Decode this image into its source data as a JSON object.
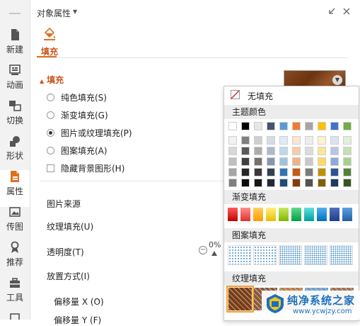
{
  "sidebar": {
    "items": [
      {
        "label": "新建",
        "icon": "new-doc-icon"
      },
      {
        "label": "动画",
        "icon": "animation-icon"
      },
      {
        "label": "切换",
        "icon": "transition-icon"
      },
      {
        "label": "形状",
        "icon": "shape-icon"
      },
      {
        "label": "属性",
        "icon": "properties-icon",
        "active": true
      },
      {
        "label": "传图",
        "icon": "upload-image-icon"
      },
      {
        "label": "推荐",
        "icon": "recommend-icon"
      },
      {
        "label": "工具",
        "icon": "toolbox-icon"
      }
    ]
  },
  "panel": {
    "title": "对象属性",
    "fill_tab": "填充",
    "section_title": "填充",
    "options": [
      {
        "label": "纯色填充(S)",
        "type": "radio",
        "selected": false
      },
      {
        "label": "渐变填充(G)",
        "type": "radio",
        "selected": false
      },
      {
        "label": "图片或纹理填充(P)",
        "type": "radio",
        "selected": true
      },
      {
        "label": "图案填充(A)",
        "type": "radio",
        "selected": false
      },
      {
        "label": "隐藏背景图形(H)",
        "type": "checkbox",
        "checked": false
      }
    ],
    "image_source_label": "图片来源",
    "texture_fill_label": "纹理填充(U)",
    "transparency_label": "透明度(T)",
    "transparency_value": "0%",
    "placement_label": "放置方式(I)",
    "offset_x_label": "偏移量 X (O)",
    "offset_y_label": "偏移量 Y (F)"
  },
  "popup": {
    "no_fill_label": "无填充",
    "theme_colors_header": "主题颜色",
    "gradient_header": "渐变填充",
    "pattern_header": "图案填充",
    "texture_header": "纹理填充",
    "theme_top_row": [
      "#ffffff",
      "#000000",
      "#e7e6e6",
      "#44546a",
      "#5b9bd5",
      "#ed7d31",
      "#a5a5a5",
      "#ffc000",
      "#4472c4",
      "#70ad47"
    ],
    "theme_shades": [
      [
        "#f2f2f2",
        "#7f7f7f",
        "#d0cece",
        "#d6dce4",
        "#deebf6",
        "#fbe5d5",
        "#ededed",
        "#fff2cc",
        "#dae3f3",
        "#e2efd9"
      ],
      [
        "#d8d8d8",
        "#595959",
        "#aeabab",
        "#adb9ca",
        "#bdd7ee",
        "#f7cbac",
        "#dbdbdb",
        "#fee599",
        "#b4c6e7",
        "#c5e0b3"
      ],
      [
        "#bfbfbf",
        "#3f3f3f",
        "#757070",
        "#8496b0",
        "#9cc3e5",
        "#f4b183",
        "#c9c9c9",
        "#ffd965",
        "#8eaadb",
        "#a8d08d"
      ],
      [
        "#a5a5a5",
        "#262626",
        "#3a3838",
        "#323f4f",
        "#2e75b5",
        "#c55a11",
        "#7b7b7b",
        "#bf9000",
        "#2f5496",
        "#538135"
      ],
      [
        "#7f7f7f",
        "#0c0c0c",
        "#171616",
        "#222a35",
        "#1e4e79",
        "#843c0b",
        "#525252",
        "#7f6000",
        "#1f3864",
        "#375623"
      ]
    ],
    "gradient_colors": [
      [
        "#c00000",
        "#ff5b5b"
      ],
      [
        "#e03030",
        "#ff9090"
      ],
      [
        "#ff9900",
        "#ffd060"
      ],
      [
        "#e6c000",
        "#fff080"
      ],
      [
        "#7fb800",
        "#c8e860"
      ],
      [
        "#00a040",
        "#60d890"
      ],
      [
        "#00a0a0",
        "#60e0e0"
      ],
      [
        "#0070c0",
        "#50b0f0"
      ],
      [
        "#1f3c88",
        "#5070c0"
      ],
      [
        "#2060a0",
        "#60a0e0"
      ]
    ],
    "pattern_colors": [
      "#4a90c8",
      "#4a90c8",
      "#4a90c8",
      "#4a90c8",
      "#4a90c8"
    ],
    "texture_colors": [
      "#7a3c14",
      "#8b5a36",
      "#c07a3c",
      "#6aa0d0",
      "#a07050"
    ]
  },
  "watermark": {
    "title": "纯净系统之家",
    "url": "www.ycwjzy.com"
  },
  "colors": {
    "accent": "#e0701f",
    "accent_text": "#c8561a",
    "sidebar_bg": "#f2f2f2",
    "header_bg": "#ececec"
  }
}
